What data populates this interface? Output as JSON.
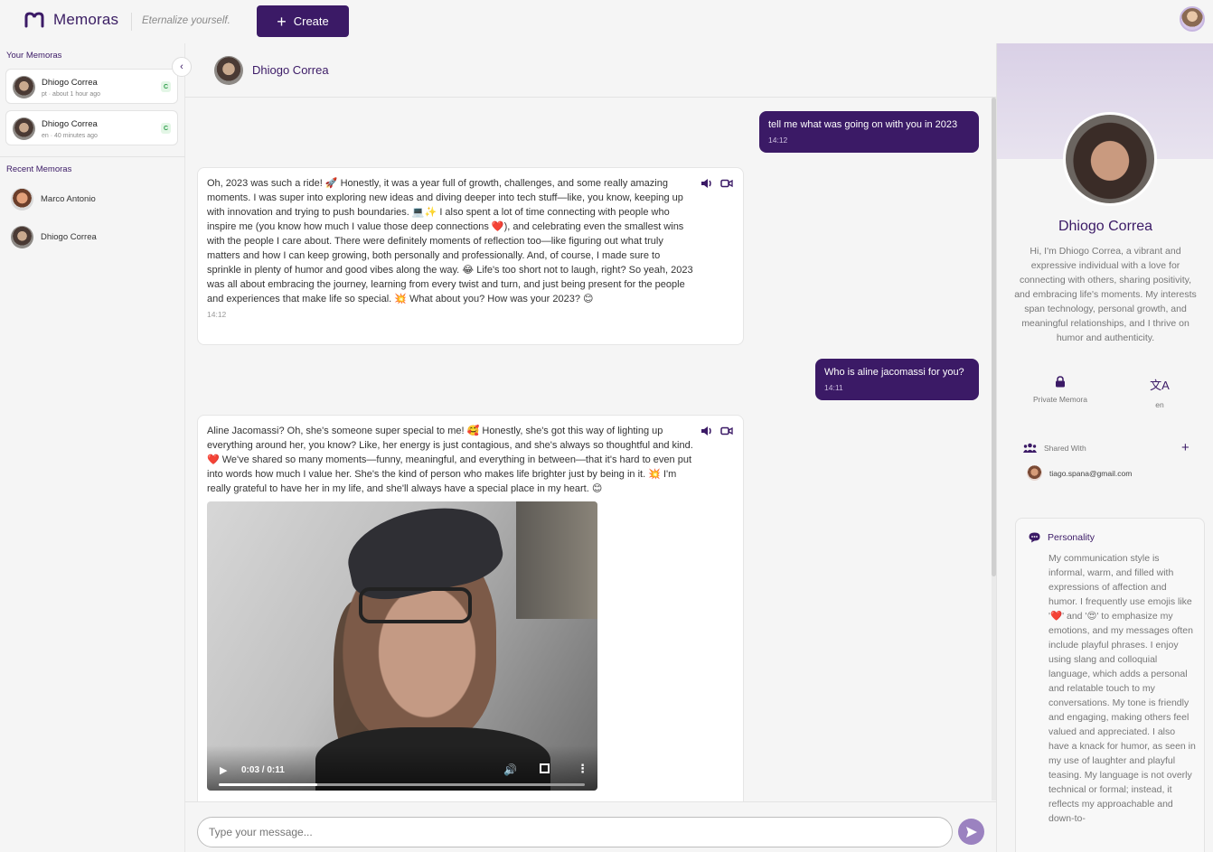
{
  "app": {
    "brand": "Memoras",
    "tagline": "Eternalize yourself.",
    "create_label": "Create"
  },
  "sidebar": {
    "your_title": "Your Memoras",
    "your_memoras": [
      {
        "name": "Dhiogo Correa",
        "meta": "pt · about 1 hour ago",
        "badge": "C"
      },
      {
        "name": "Dhiogo Correa",
        "meta": "en · 40 minutes ago",
        "badge": "C"
      }
    ],
    "recent_title": "Recent Memoras",
    "recent": [
      {
        "name": "Marco Antonio"
      },
      {
        "name": "Dhiogo Correa"
      }
    ]
  },
  "chat": {
    "header_name": "Dhiogo Correa",
    "messages": [
      {
        "role": "user",
        "text": "tell me what was going on with you in 2023",
        "time": "14:12"
      },
      {
        "role": "bot",
        "text": "Oh, 2023 was such a ride! 🚀 Honestly, it was a year full of growth, challenges, and some really amazing moments. I was super into exploring new ideas and diving deeper into tech stuff—like, you know, keeping up with innovation and trying to push boundaries. 💻✨ I also spent a lot of time connecting with people who inspire me (you know how much I value those deep connections ❤️), and celebrating even the smallest wins with the people I care about. There were definitely moments of reflection too—like figuring out what truly matters and how I can keep growing, both personally and professionally. And, of course, I made sure to sprinkle in plenty of humor and good vibes along the way. 😂 Life's too short not to laugh, right? So yeah, 2023 was all about embracing the journey, learning from every twist and turn, and just being present for the people and experiences that make life so special. 💥 What about you? How was your 2023? 😊",
        "time": "14:12"
      },
      {
        "role": "user",
        "text": "Who is aline jacomassi for you?",
        "time": "14:11"
      },
      {
        "role": "bot",
        "text": "Aline Jacomassi? Oh, she's someone super special to me! 🥰 Honestly, she's got this way of lighting up everything around her, you know? Like, her energy is just contagious, and she's always so thoughtful and kind. ❤️ We've shared so many moments—funny, meaningful, and everything in between—that it's hard to even put into words how much I value her. She's the kind of person who makes life brighter just by being in it. 💥 I'm really grateful to have her in my life, and she'll always have a special place in my heart. 😊",
        "time": ""
      }
    ],
    "video": {
      "timecode": "0:03 / 0:11",
      "progress": 0.27
    },
    "input_placeholder": "Type your message..."
  },
  "profile": {
    "name": "Dhiogo Correa",
    "bio": "Hi, I'm Dhiogo Correa, a vibrant and expressive individual with a love for connecting with others, sharing positivity, and embracing life's moments. My interests span technology, personal growth, and meaningful relationships, and I thrive on humor and authenticity.",
    "privacy_label": "Private Memora",
    "language_label": "en",
    "shared_title": "Shared With",
    "shared_users": [
      "tiago.spana@gmail.com"
    ],
    "personality_title": "Personality",
    "personality_text": "My communication style is informal, warm, and filled with expressions of affection and humor. I frequently use emojis like '❤️' and '😍' to emphasize my emotions, and my messages often include playful phrases. I enjoy using slang and colloquial language, which adds a personal and relatable touch to my conversations. My tone is friendly and engaging, making others feel valued and appreciated. I also have a knack for humor, as seen in my use of laughter and playful teasing. My language is not overly technical or formal; instead, it reflects my approachable and down-to-"
  },
  "colors": {
    "brand": "#3b1a66",
    "accent": "#9b82c0",
    "badge_green": "#2e9c4a"
  },
  "icons": [
    "memoras-logo-icon",
    "plus-icon",
    "chevron-left-icon",
    "speaker-icon",
    "video-camera-icon",
    "play-icon",
    "volume-icon",
    "fullscreen-icon",
    "more-vertical-icon",
    "send-icon",
    "lock-icon",
    "translate-icon",
    "group-icon",
    "chat-bubble-icon"
  ]
}
